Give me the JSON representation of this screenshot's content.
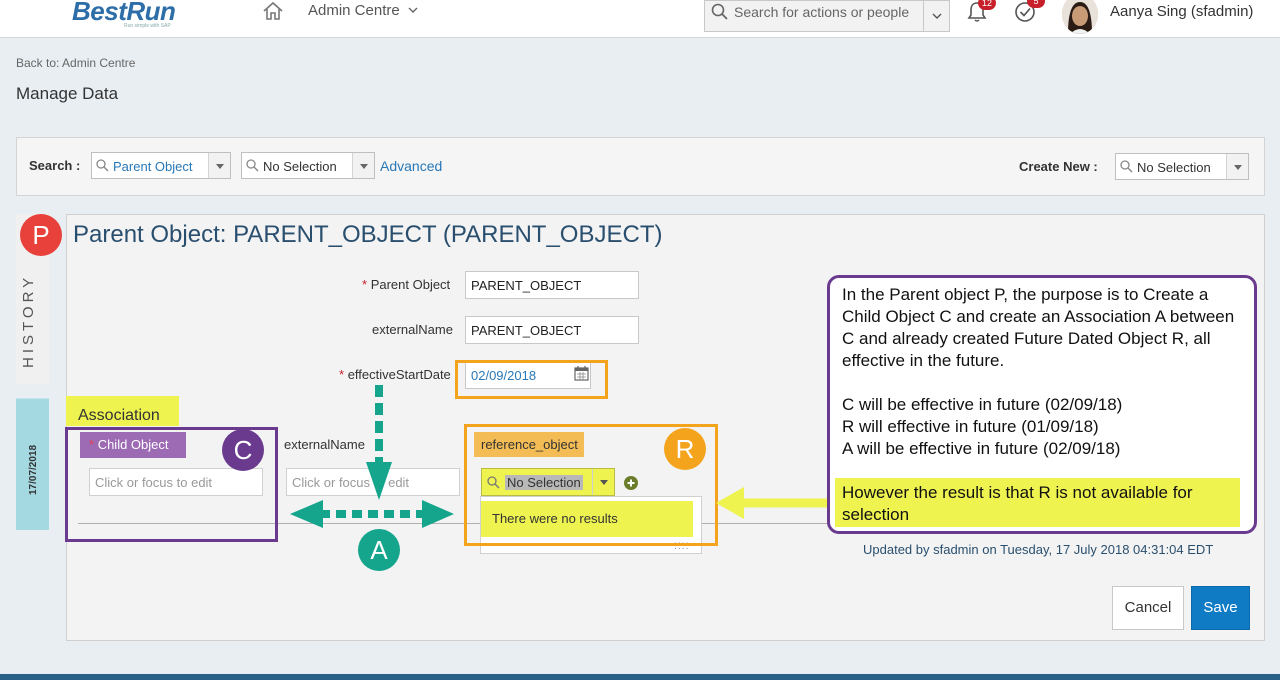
{
  "header": {
    "logo_text": "BestRun",
    "logo_tagline": "Run simple with SAP",
    "nav_label": "Admin Centre",
    "search_placeholder": "Search for actions or people",
    "notifications_count": "12",
    "approvals_count": "5",
    "user_name": "Aanya Sing (sfadmin)"
  },
  "page": {
    "back_link": "Back to: Admin Centre",
    "title": "Manage Data"
  },
  "search_bar": {
    "search_label": "Search :",
    "object_type_value": "Parent Object",
    "object_value": "No Selection",
    "advanced_link": "Advanced",
    "create_new_label": "Create New :",
    "create_new_value": "No Selection"
  },
  "side_tabs": {
    "history": "HISTORY",
    "effective_date": "17/07/2018"
  },
  "record": {
    "title": "Parent Object: PARENT_OBJECT (PARENT_OBJECT)",
    "fields": {
      "parent_object_label": "Parent Object",
      "parent_object_value": "PARENT_OBJECT",
      "external_name_label": "externalName",
      "external_name_value": "PARENT_OBJECT",
      "effective_start_label": "effectiveStartDate",
      "effective_start_value": "02/09/2018",
      "required_marker": "*"
    },
    "association": {
      "section_label": "Association",
      "child_object_label": "Child Object",
      "external_name_label": "externalName",
      "reference_object_label": "reference_object",
      "child_placeholder": "Click or focus to edit",
      "external_name_placeholder": "Click or focus to edit",
      "reference_value": "No Selection",
      "no_results": "There were no results"
    },
    "updated_text": "Updated by sfadmin on Tuesday, 17 July 2018 04:31:04 EDT",
    "cancel_label": "Cancel",
    "save_label": "Save"
  },
  "annotations": {
    "marker_p": "P",
    "marker_c": "C",
    "marker_r": "R",
    "marker_a": "A",
    "callout_lines": [
      "In the Parent object P, the purpose is to Create a Child Object C and  create an Association A between C and already created Future Dated Object R, all effective in the future.",
      "C will be effective in future (02/09/18)",
      "R will effective in future (01/09/18)",
      "A will be effective in future (02/09/18)"
    ],
    "callout_highlight": "However the result is that  R is not available for selection"
  },
  "colors": {
    "marker_p": "#e8403a",
    "marker_c": "#6a3a8f",
    "marker_r": "#f4a41c",
    "marker_a": "#14a58c",
    "highlight": "#eef34f",
    "accent": "#0f7bc4"
  }
}
